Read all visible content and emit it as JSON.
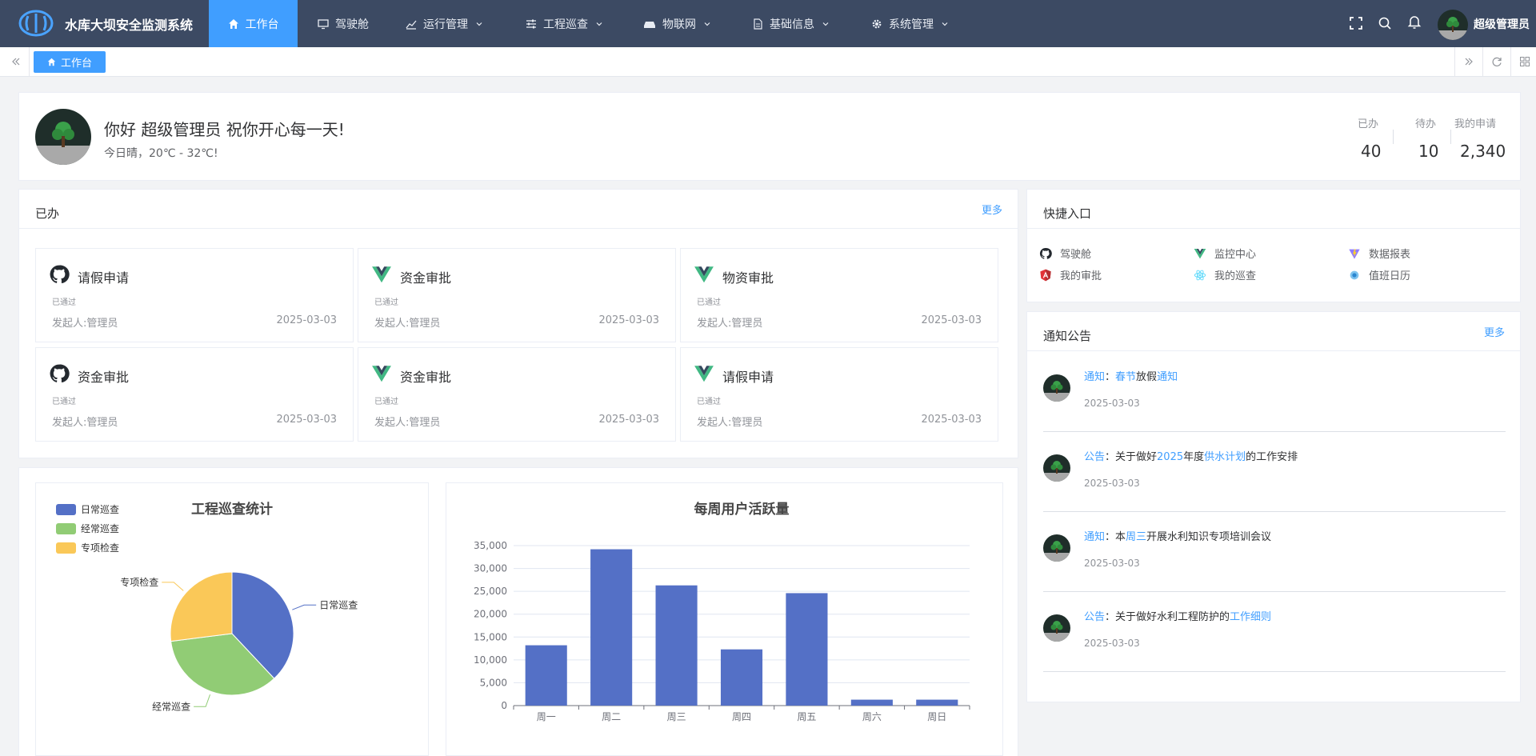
{
  "header": {
    "title": "水库大坝安全监测系统",
    "nav": [
      {
        "label": "工作台",
        "icon": "home-icon",
        "active": true
      },
      {
        "label": "驾驶舱",
        "icon": "monitor-icon"
      },
      {
        "label": "运行管理",
        "icon": "chart-icon"
      },
      {
        "label": "工程巡查",
        "icon": "sliders-icon"
      },
      {
        "label": "物联网",
        "icon": "device-icon"
      },
      {
        "label": "基础信息",
        "icon": "document-icon"
      },
      {
        "label": "系统管理",
        "icon": "gear-icon"
      }
    ],
    "user": "超级管理员"
  },
  "tags": {
    "active": "工作台"
  },
  "welcome": {
    "greeting": "你好 超级管理员 祝你开心每一天!",
    "weather": "今日晴，20℃ - 32℃!",
    "stats": [
      {
        "label": "已办",
        "value": "40"
      },
      {
        "label": "待办",
        "value": "10"
      },
      {
        "label": "我的申请",
        "value": "2,340"
      }
    ]
  },
  "done": {
    "title": "已办",
    "more": "更多",
    "items": [
      {
        "icon": "github-icon",
        "title": "请假申请",
        "status": "已通过",
        "by": "发起人:管理员",
        "date": "2025-03-03"
      },
      {
        "icon": "vue-icon",
        "title": "资金审批",
        "status": "已通过",
        "by": "发起人:管理员",
        "date": "2025-03-03"
      },
      {
        "icon": "vue-icon",
        "title": "物资审批",
        "status": "已通过",
        "by": "发起人:管理员",
        "date": "2025-03-03"
      },
      {
        "icon": "github-icon",
        "title": "资金审批",
        "status": "已通过",
        "by": "发起人:管理员",
        "date": "2025-03-03"
      },
      {
        "icon": "vue-icon",
        "title": "资金审批",
        "status": "已通过",
        "by": "发起人:管理员",
        "date": "2025-03-03"
      },
      {
        "icon": "vue-icon",
        "title": "请假申请",
        "status": "已通过",
        "by": "发起人:管理员",
        "date": "2025-03-03"
      }
    ]
  },
  "quick": {
    "title": "快捷入口",
    "items": [
      {
        "icon": "github-icon",
        "label": "驾驶舱"
      },
      {
        "icon": "vue-icon",
        "label": "监控中心"
      },
      {
        "icon": "vite-icon",
        "label": "数据报表"
      },
      {
        "icon": "angular-icon",
        "label": "我的审批"
      },
      {
        "icon": "react-icon",
        "label": "我的巡查"
      },
      {
        "icon": "dot-icon",
        "label": "值班日历"
      }
    ]
  },
  "notices": {
    "title": "通知公告",
    "more": "更多",
    "items": [
      {
        "parts": [
          {
            "t": "通知",
            "hl": true
          },
          {
            "t": "：",
            "hl": false
          },
          {
            "t": "春节",
            "hl": true
          },
          {
            "t": "放假",
            "hl": false
          },
          {
            "t": "通知",
            "hl": true
          }
        ],
        "date": "2025-03-03"
      },
      {
        "parts": [
          {
            "t": "公告",
            "hl": true
          },
          {
            "t": "：关于做好",
            "hl": false
          },
          {
            "t": "2025",
            "hl": true
          },
          {
            "t": "年度",
            "hl": false
          },
          {
            "t": "供水计划",
            "hl": true
          },
          {
            "t": "的工作安排",
            "hl": false
          }
        ],
        "date": "2025-03-03"
      },
      {
        "parts": [
          {
            "t": "通知",
            "hl": true
          },
          {
            "t": "：本",
            "hl": false
          },
          {
            "t": "周三",
            "hl": true
          },
          {
            "t": "开展水利知识专项培训会议",
            "hl": false
          }
        ],
        "date": "2025-03-03"
      },
      {
        "parts": [
          {
            "t": "公告",
            "hl": true
          },
          {
            "t": "：关于做好水利工程防护的",
            "hl": false
          },
          {
            "t": "工作细则",
            "hl": true
          }
        ],
        "date": "2025-03-03"
      }
    ]
  },
  "chart_data": [
    {
      "type": "pie",
      "title": "工程巡查统计",
      "legend_position": "top-left",
      "categories": [
        "日常巡查",
        "经常巡查",
        "专项检查"
      ],
      "values": [
        38,
        35,
        27
      ],
      "colors": [
        "#5470c6",
        "#91cc75",
        "#fac858"
      ]
    },
    {
      "type": "bar",
      "title": "每周用户活跃量",
      "categories": [
        "周一",
        "周二",
        "周三",
        "周四",
        "周五",
        "周六",
        "周日"
      ],
      "values": [
        13200,
        34200,
        26300,
        12300,
        24600,
        1300,
        1300
      ],
      "ylim": [
        0,
        35000
      ],
      "yticks": [
        0,
        5000,
        10000,
        15000,
        20000,
        25000,
        30000,
        35000
      ],
      "ytick_labels": [
        "0",
        "5,000",
        "10,000",
        "15,000",
        "20,000",
        "25,000",
        "30,000",
        "35,000"
      ],
      "grid": true,
      "color": "#5470c6"
    }
  ]
}
